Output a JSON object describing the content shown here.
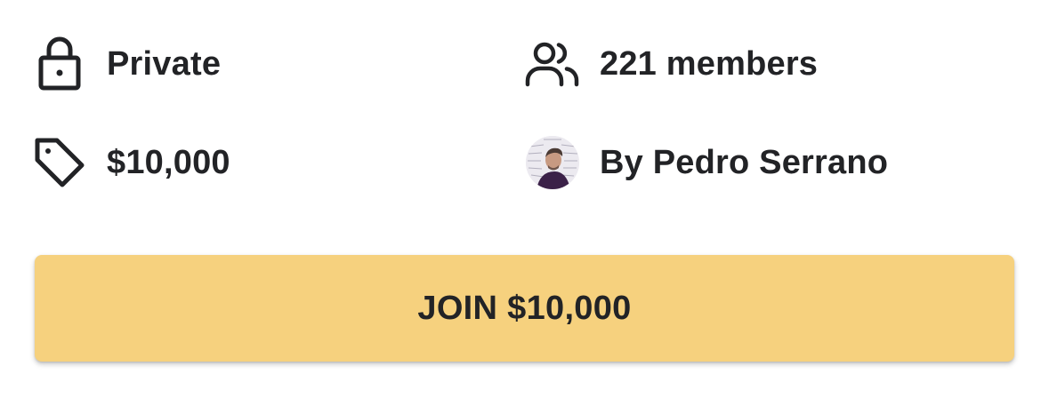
{
  "theme": {
    "text_color": "#222326",
    "button_color": "#F6D17E"
  },
  "details": {
    "privacy": {
      "icon": "lock-icon",
      "label": "Private"
    },
    "members": {
      "icon": "users-icon",
      "label": "221 members"
    },
    "price": {
      "icon": "tag-icon",
      "label": "$10,000"
    },
    "author": {
      "icon": "avatar",
      "label": "By Pedro Serrano"
    }
  },
  "join_button": {
    "label": "JOIN $10,000"
  }
}
